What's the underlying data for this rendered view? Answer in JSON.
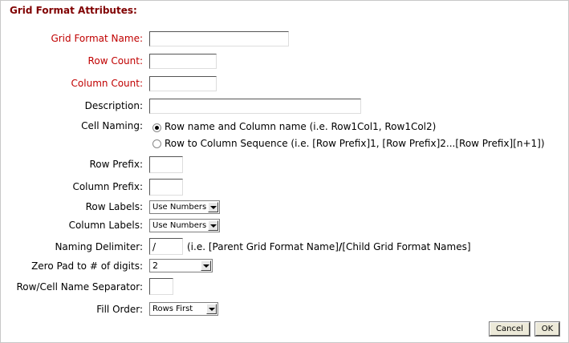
{
  "header": {
    "title": "Grid Format Attributes:"
  },
  "fields": {
    "grid_format_name": {
      "label": "Grid Format Name:",
      "value": ""
    },
    "row_count": {
      "label": "Row Count:",
      "value": ""
    },
    "column_count": {
      "label": "Column Count:",
      "value": ""
    },
    "description": {
      "label": "Description:",
      "value": ""
    },
    "cell_naming": {
      "label": "Cell Naming:",
      "options": [
        "Row name and Column name (i.e. Row1Col1, Row1Col2)",
        "Row to Column Sequence (i.e. [Row Prefix]1, [Row Prefix]2...[Row Prefix][n+1])"
      ],
      "selected_index": 0
    },
    "row_prefix": {
      "label": "Row Prefix:",
      "value": ""
    },
    "column_prefix": {
      "label": "Column Prefix:",
      "value": ""
    },
    "row_labels": {
      "label": "Row Labels:",
      "value": "Use Numbers"
    },
    "column_labels": {
      "label": "Column Labels:",
      "value": "Use Numbers"
    },
    "naming_delimiter": {
      "label": "Naming Delimiter:",
      "value": "/",
      "hint_prefix": "(i.e. [Parent Grid Format Name]",
      "hint_sep": "/",
      "hint_suffix": "[Child Grid Format Names]"
    },
    "zero_pad": {
      "label": "Zero Pad to # of digits:",
      "value": "2"
    },
    "name_separator": {
      "label": "Row/Cell Name Separator:",
      "value": ""
    },
    "fill_order": {
      "label": "Fill Order:",
      "value": "Rows First"
    }
  },
  "buttons": {
    "cancel": "Cancel",
    "ok": "OK"
  },
  "colors": {
    "required_label": "#c00000",
    "header": "#800000"
  }
}
